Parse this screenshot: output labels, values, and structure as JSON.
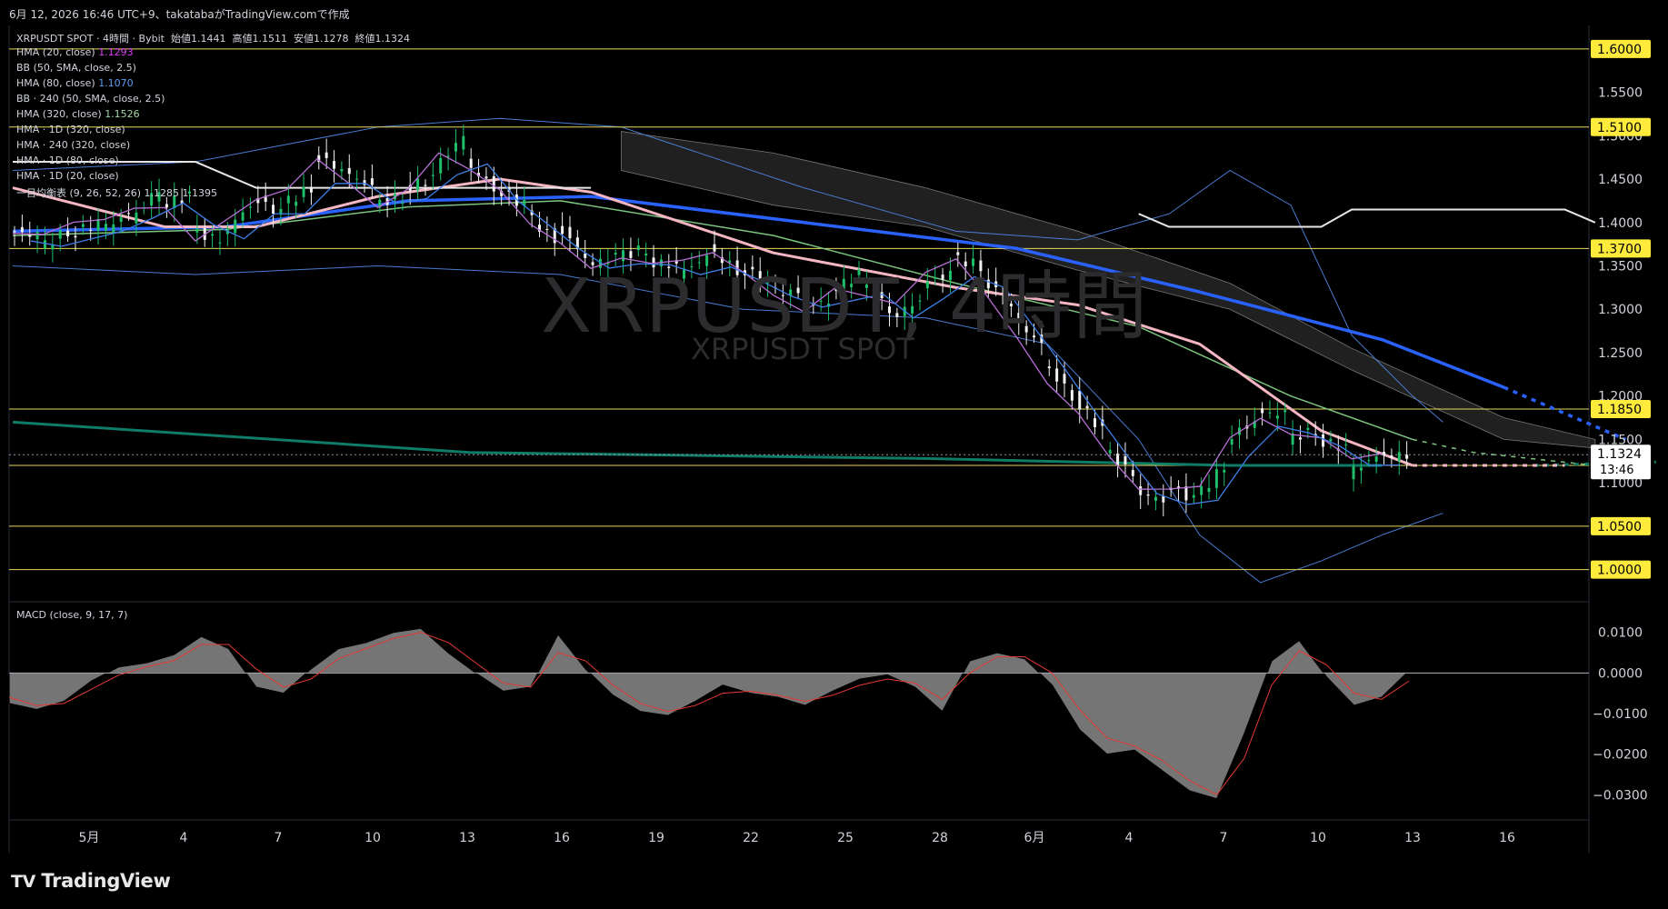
{
  "header": {
    "created_text": "6月 12, 2026 16:46 UTC+9、takatabaがTradingView.comで作成"
  },
  "symbol_info": {
    "symbol": "XRPUSDT SPOT",
    "interval": "4時間",
    "exchange": "Bybit",
    "open_label": "始値",
    "open": "1.1441",
    "high_label": "高値",
    "high": "1.1511",
    "low_label": "安値",
    "low": "1.1278",
    "close_label": "終値",
    "close": "1.1324"
  },
  "watermark": {
    "title": "XRPUSDT, 4時間",
    "subtitle": "XRPUSDT SPOT"
  },
  "indicators": [
    {
      "label": "HMA (20, close)",
      "value": "1.1293",
      "color": "#e040fb"
    },
    {
      "label": "BB (50, SMA, close, 2.5)",
      "value": "",
      "color": "#d1d4dc"
    },
    {
      "label": "HMA (80, close)",
      "value": "1.1070",
      "color": "#5b9cf6"
    },
    {
      "label": "BB · 240 (50, SMA, close, 2.5)",
      "value": "",
      "color": "#d1d4dc"
    },
    {
      "label": "HMA (320, close)",
      "value": "1.1526",
      "color": "#a5d6a7"
    },
    {
      "label": "HMA · 1D (320, close)",
      "value": "",
      "color": "#d1d4dc"
    },
    {
      "label": "HMA · 240 (320, close)",
      "value": "",
      "color": "#d1d4dc"
    },
    {
      "label": "HMA · 1D (80, close)",
      "value": "",
      "color": "#d1d4dc"
    },
    {
      "label": "HMA · 1D (20, close)",
      "value": "",
      "color": "#d1d4dc"
    },
    {
      "label": "一目均衡表 (9, 26, 52, 26)",
      "value": "1.1285  1.1395",
      "color": "#d1d4dc"
    }
  ],
  "colors": {
    "up": "#1fbf6a",
    "down": "#f2f2f2",
    "hma20": "#b76fd6",
    "hma80": "#3d7ee6",
    "hma320": "#7bc47f",
    "pink": "#f4b6c2",
    "blue_thick": "#2962ff",
    "teal": "#0e7c66",
    "level_line": "#e8d85a",
    "level_tag": "#ffeb3b",
    "macd_hist": "#8a8a8a",
    "signal": "#e53935"
  },
  "chart_data": {
    "type": "candlestick",
    "title": "XRPUSDT, 4時間",
    "price_axis": {
      "min": 0.965,
      "max": 1.625,
      "ticks": [
        "1.6000",
        "1.5500",
        "1.5000",
        "1.4500",
        "1.4000",
        "1.3500",
        "1.3000",
        "1.2500",
        "1.2000",
        "1.1500",
        "1.1000",
        "1.0500",
        "1.0000"
      ]
    },
    "horizontal_levels": [
      "1.6000",
      "1.5100",
      "1.3700",
      "1.1850",
      "1.1200",
      "1.0500",
      "1.0000"
    ],
    "last_price": {
      "value": "1.1324",
      "countdown": "13:46"
    },
    "x_axis_labels": [
      "5月",
      "4",
      "7",
      "10",
      "13",
      "16",
      "19",
      "22",
      "25",
      "28",
      "6月",
      "4",
      "7",
      "10",
      "13",
      "16"
    ],
    "price_path": [
      [
        1.39,
        1.385
      ],
      [
        1.37,
        1.39
      ],
      [
        1.385,
        1.4
      ],
      [
        1.39,
        1.41
      ],
      [
        1.4,
        1.44
      ],
      [
        1.42,
        1.43
      ],
      [
        1.39,
        1.38
      ],
      [
        1.385,
        1.42
      ],
      [
        1.43,
        1.41
      ],
      [
        1.42,
        1.44
      ],
      [
        1.48,
        1.46
      ],
      [
        1.46,
        1.44
      ],
      [
        1.42,
        1.43
      ],
      [
        1.44,
        1.45
      ],
      [
        1.46,
        1.5
      ],
      [
        1.47,
        1.44
      ],
      [
        1.44,
        1.42
      ],
      [
        1.41,
        1.38
      ],
      [
        1.4,
        1.36
      ],
      [
        1.35,
        1.36
      ],
      [
        1.36,
        1.37
      ],
      [
        1.355,
        1.35
      ],
      [
        1.34,
        1.36
      ],
      [
        1.37,
        1.345
      ],
      [
        1.35,
        1.33
      ],
      [
        1.32,
        1.32
      ],
      [
        1.3,
        1.31
      ],
      [
        1.32,
        1.34
      ],
      [
        1.33,
        1.3
      ],
      [
        1.29,
        1.31
      ],
      [
        1.33,
        1.34
      ],
      [
        1.36,
        1.35
      ],
      [
        1.34,
        1.3
      ],
      [
        1.29,
        1.26
      ],
      [
        1.24,
        1.2
      ],
      [
        1.2,
        1.16
      ],
      [
        1.14,
        1.11
      ],
      [
        1.09,
        1.08
      ],
      [
        1.1,
        1.08
      ],
      [
        1.08,
        1.12
      ],
      [
        1.15,
        1.17
      ],
      [
        1.18,
        1.18
      ],
      [
        1.15,
        1.16
      ],
      [
        1.15,
        1.14
      ],
      [
        1.11,
        1.13
      ],
      [
        1.13,
        1.1324
      ]
    ],
    "ma_lines": {
      "hma320": [
        [
          0,
          1.385
        ],
        [
          7,
          1.392
        ],
        [
          13,
          1.418
        ],
        [
          18,
          1.425
        ],
        [
          25,
          1.385
        ],
        [
          31,
          1.33
        ],
        [
          37,
          1.28
        ],
        [
          42,
          1.2
        ],
        [
          46,
          1.15
        ],
        [
          48,
          1.135
        ],
        [
          52,
          1.12
        ]
      ],
      "blue_thick": [
        [
          0,
          1.39
        ],
        [
          7,
          1.395
        ],
        [
          13,
          1.425
        ],
        [
          19,
          1.43
        ],
        [
          26,
          1.4
        ],
        [
          33,
          1.37
        ],
        [
          39,
          1.32
        ],
        [
          45,
          1.265
        ],
        [
          49,
          1.21
        ],
        [
          53,
          1.15
        ]
      ],
      "pink": [
        [
          0,
          1.44
        ],
        [
          5,
          1.395
        ],
        [
          8,
          1.395
        ],
        [
          12,
          1.43
        ],
        [
          16,
          1.45
        ],
        [
          19,
          1.435
        ],
        [
          25,
          1.365
        ],
        [
          31,
          1.325
        ],
        [
          35,
          1.305
        ],
        [
          39,
          1.26
        ],
        [
          43,
          1.16
        ],
        [
          46,
          1.12
        ],
        [
          48,
          1.12
        ],
        [
          51,
          1.12
        ]
      ],
      "teal": [
        [
          0,
          1.17
        ],
        [
          15,
          1.135
        ],
        [
          30,
          1.128
        ],
        [
          40,
          1.12
        ],
        [
          45,
          1.12
        ],
        [
          50,
          1.12
        ],
        [
          54,
          1.124
        ]
      ],
      "white_step": [
        [
          0,
          1.47
        ],
        [
          6,
          1.47
        ],
        [
          8,
          1.44
        ],
        [
          19,
          1.44
        ]
      ],
      "white_step2": [
        [
          37,
          1.41
        ],
        [
          38,
          1.395
        ],
        [
          43,
          1.395
        ],
        [
          44,
          1.415
        ],
        [
          51,
          1.415
        ],
        [
          52,
          1.4
        ]
      ]
    },
    "macd": {
      "title": "MACD (close, 9, 17, 7)",
      "ticks": [
        "0.0100",
        "0.0000",
        "-0.0100",
        "-0.0200",
        "-0.0300"
      ],
      "range": [
        -0.0335,
        0.0135
      ],
      "hist": [
        -0.0075,
        -0.009,
        -0.007,
        -0.002,
        0.0015,
        0.0025,
        0.0045,
        0.009,
        0.006,
        -0.0035,
        -0.005,
        0.001,
        0.006,
        0.0075,
        0.01,
        0.011,
        0.005,
        0.0,
        -0.0045,
        -0.0035,
        0.0095,
        0.001,
        -0.0055,
        -0.0095,
        -0.0105,
        -0.007,
        -0.003,
        -0.005,
        -0.006,
        -0.008,
        -0.0045,
        -0.0015,
        -0.0005,
        -0.0035,
        -0.0095,
        0.003,
        0.005,
        0.0035,
        -0.003,
        -0.014,
        -0.02,
        -0.019,
        -0.024,
        -0.029,
        -0.031,
        -0.015,
        0.003,
        0.008,
        -0.001,
        -0.008,
        -0.006,
        0.0005
      ],
      "signal": [
        -0.006,
        -0.008,
        -0.0075,
        -0.004,
        -0.0005,
        0.0015,
        0.003,
        0.007,
        0.007,
        0.001,
        -0.0035,
        -0.0015,
        0.0035,
        0.006,
        0.0085,
        0.01,
        0.0075,
        0.0025,
        -0.0025,
        -0.0035,
        0.005,
        0.003,
        -0.003,
        -0.0075,
        -0.0095,
        -0.008,
        -0.005,
        -0.0045,
        -0.0055,
        -0.007,
        -0.0055,
        -0.003,
        -0.0015,
        -0.0025,
        -0.0065,
        0.0,
        0.004,
        0.004,
        0.0,
        -0.009,
        -0.016,
        -0.018,
        -0.0215,
        -0.0265,
        -0.03,
        -0.021,
        -0.003,
        0.0055,
        0.002,
        -0.005,
        -0.0065,
        -0.002
      ]
    }
  },
  "footer": {
    "logo_text": "TradingView"
  }
}
